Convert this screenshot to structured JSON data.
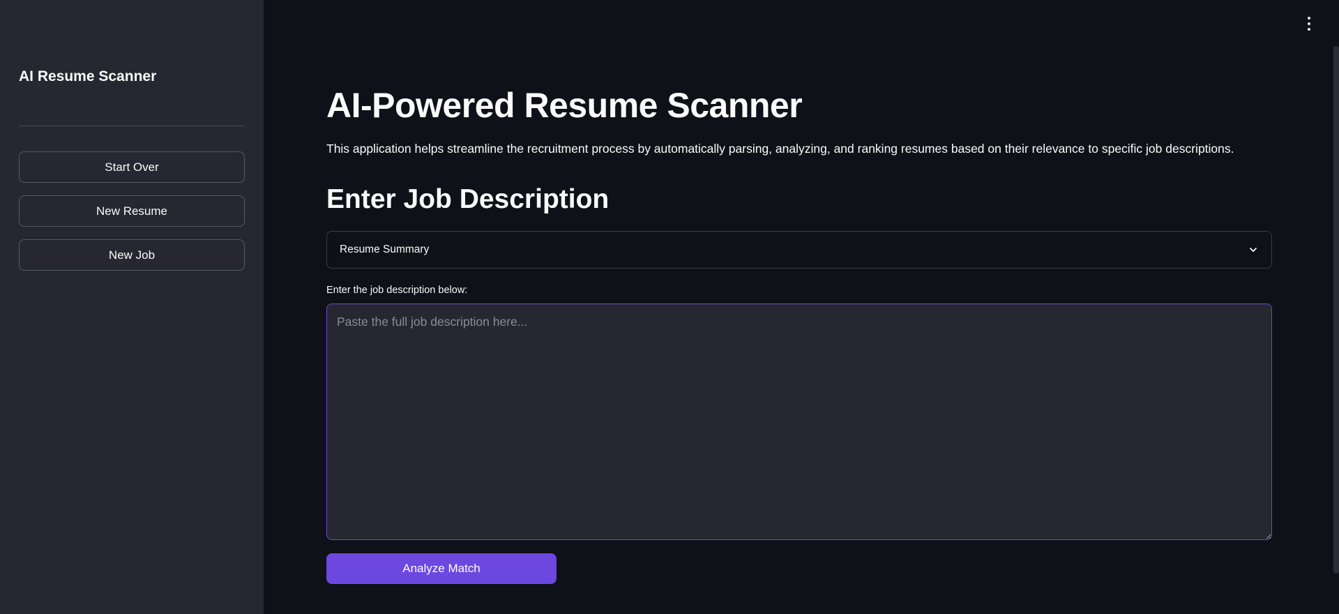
{
  "sidebar": {
    "title": "AI Resume Scanner",
    "buttons": [
      {
        "label": "Start Over"
      },
      {
        "label": "New Resume"
      },
      {
        "label": "New Job"
      }
    ]
  },
  "main": {
    "title": "AI-Powered Resume Scanner",
    "description": "This application helps streamline the recruitment process by automatically parsing, analyzing, and ranking resumes based on their relevance to specific job descriptions.",
    "section_title": "Enter Job Description",
    "select": {
      "selected": "Resume Summary",
      "icon": "chevron-down-icon"
    },
    "job_input": {
      "label": "Enter the job description below:",
      "value": "",
      "placeholder": "Paste the full job description here..."
    },
    "analyze_label": "Analyze Match"
  },
  "icons": {
    "menu": "kebab-menu-icon"
  },
  "colors": {
    "background": "#0e1117",
    "sidebar": "#262730",
    "accent": "#6c47e0",
    "text": "#fafafa"
  }
}
